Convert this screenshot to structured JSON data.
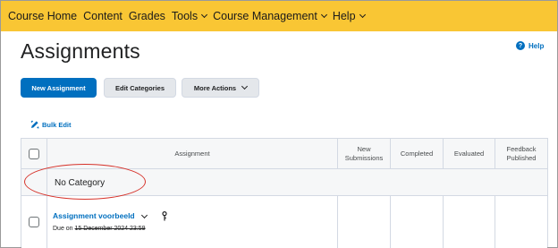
{
  "nav": {
    "items": [
      {
        "label": "Course Home",
        "dropdown": false
      },
      {
        "label": "Content",
        "dropdown": false
      },
      {
        "label": "Grades",
        "dropdown": false
      },
      {
        "label": "Tools",
        "dropdown": true
      },
      {
        "label": "Course Management",
        "dropdown": true
      },
      {
        "label": "Help",
        "dropdown": true
      }
    ]
  },
  "page": {
    "title": "Assignments",
    "help_label": "Help"
  },
  "toolbar": {
    "new_assignment_label": "New Assignment",
    "edit_categories_label": "Edit Categories",
    "more_actions_label": "More Actions"
  },
  "bulk_edit_label": "Bulk Edit",
  "table": {
    "columns": [
      "Assignment",
      "New Submissions",
      "Completed",
      "Evaluated",
      "Feedback Published"
    ],
    "category": "No Category",
    "rows": [
      {
        "title": "Assignment voorbeeld",
        "due_prefix": "Due on",
        "due_date": "15 December 2024 23:59"
      }
    ]
  },
  "colors": {
    "navbar_bg": "#f9c634",
    "primary": "#006fbf",
    "annotation_red": "#d6322a"
  }
}
